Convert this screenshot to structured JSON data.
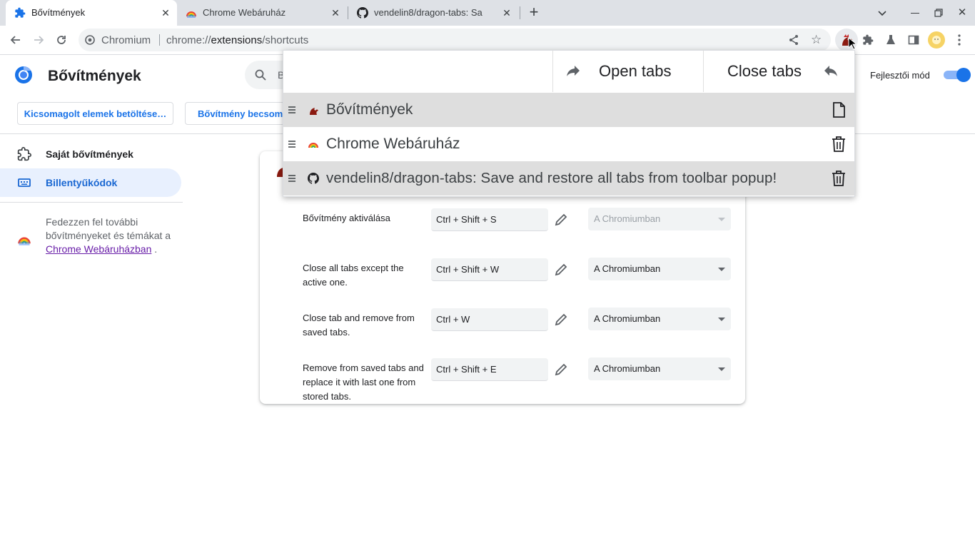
{
  "browser": {
    "tabs": [
      {
        "title": "Bővítmények",
        "icon": "puzzle-icon",
        "active": true
      },
      {
        "title": "Chrome Webáruház",
        "icon": "webstore-icon",
        "active": false
      },
      {
        "title": "vendelin8/dragon-tabs: Sa",
        "icon": "github-icon",
        "active": false
      }
    ],
    "omnibox": {
      "site_chip": "Chromium",
      "url_pre": "chrome://",
      "url_host": "extensions",
      "url_path": "/shortcuts"
    }
  },
  "page": {
    "title": "Bővítmények",
    "search_placeholder": "B",
    "dev_mode_label": "Fejlesztői mód",
    "dev_mode_on": true,
    "buttons": {
      "load_unpacked": "Kicsomagolt elemek betöltése…",
      "pack_extension": "Bővítmény becsoma"
    },
    "sidebar": {
      "items": [
        {
          "label": "Saját bővítmények",
          "icon": "extension-icon",
          "selected": false
        },
        {
          "label": "Billentyűkódok",
          "icon": "keyboard-icon",
          "selected": true
        }
      ],
      "promo_text": "Fedezzen fel további bővítményeket és témákat a",
      "promo_link": "Chrome Webáruházban",
      "promo_end": "."
    },
    "shortcuts": [
      {
        "desc": "Bővítmény aktiválása",
        "key": "Ctrl + Shift + S",
        "scope": "A Chromiumban",
        "disabled": true
      },
      {
        "desc": "Close all tabs except the active one.",
        "key": "Ctrl + Shift + W",
        "scope": "A Chromiumban",
        "disabled": false
      },
      {
        "desc": "Close tab and remove from saved tabs.",
        "key": "Ctrl + W",
        "scope": "A Chromiumban",
        "disabled": false
      },
      {
        "desc": "Remove from saved tabs and replace it with last one from stored tabs.",
        "key": "Ctrl + Shift + E",
        "scope": "A Chromiumban",
        "disabled": false
      }
    ]
  },
  "popup": {
    "open_tabs_label": "Open tabs",
    "close_tabs_label": "Close tabs",
    "rows": [
      {
        "title": "Bővítmények",
        "icon": "dragon-icon",
        "action_icon": "file-icon"
      },
      {
        "title": "Chrome Webáruház",
        "icon": "webstore-icon",
        "action_icon": "trash-icon"
      },
      {
        "title": "vendelin8/dragon-tabs: Save and restore all tabs from toolbar popup!",
        "icon": "github-icon",
        "action_icon": "trash-icon"
      }
    ]
  },
  "colors": {
    "accent": "#1a73e8",
    "tabstrip": "#dee1e6",
    "selected_bg": "#e8f0fe",
    "popup_row_shade": "#dedede"
  }
}
